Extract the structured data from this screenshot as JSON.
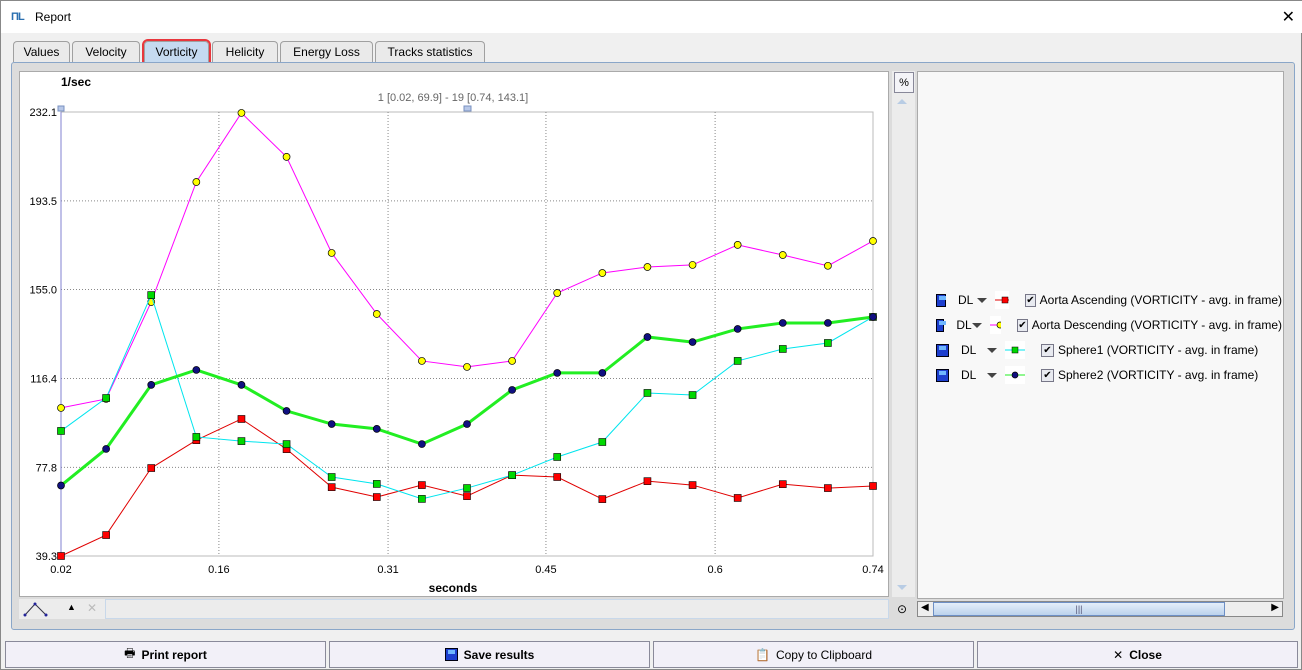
{
  "window": {
    "title": "Report"
  },
  "tabs": [
    {
      "label": "Values"
    },
    {
      "label": "Velocity"
    },
    {
      "label": "Vorticity",
      "active": true
    },
    {
      "label": "Helicity"
    },
    {
      "label": "Energy Loss"
    },
    {
      "label": "Tracks statistics"
    }
  ],
  "percent_button": "%",
  "legend": [
    {
      "dl": "DL",
      "label": "Aorta Ascending (VORTICITY  - avg. in frame)",
      "line": "#e00000",
      "marker": "#ff0000",
      "shape": "square",
      "checked": true
    },
    {
      "dl": "DL",
      "label": "Aorta Descending (VORTICITY  - avg. in frame)",
      "line": "#ff00ff",
      "marker": "#ffff00",
      "shape": "circle",
      "checked": true
    },
    {
      "dl": "DL",
      "label": "Sphere1 (VORTICITY  - avg. in frame)",
      "line": "#00e5ee",
      "marker": "#00d800",
      "shape": "square",
      "checked": true
    },
    {
      "dl": "DL",
      "label": "Sphere2 (VORTICITY  - avg. in frame)",
      "line": "#22ee22",
      "marker": "#101080",
      "shape": "circle",
      "checked": true
    }
  ],
  "buttons": {
    "print": "Print report",
    "save": "Save results",
    "copy": "Copy to Clipboard",
    "close": "Close"
  },
  "chart_data": {
    "type": "line",
    "ylabel": "1/sec",
    "xlabel": "seconds",
    "cursor_readout": "1 [0.02, 69.9] - 19 [0.74, 143.1]",
    "xlim": [
      0.02,
      0.74
    ],
    "ylim": [
      39.3,
      232.1
    ],
    "xticks": [
      "0.02",
      "0.16",
      "0.31",
      "0.45",
      "0.6",
      "0.74"
    ],
    "yticks": [
      "39.3",
      "77.8",
      "116.4",
      "155.0",
      "193.5",
      "232.1"
    ],
    "grid": true,
    "x": [
      0.02,
      0.06,
      0.1,
      0.14,
      0.18,
      0.22,
      0.26,
      0.3,
      0.34,
      0.38,
      0.42,
      0.46,
      0.5,
      0.54,
      0.58,
      0.62,
      0.66,
      0.7,
      0.74
    ],
    "series": [
      {
        "name": "Aorta Ascending (VORTICITY  - avg. in frame)",
        "values": [
          39.3,
          48.4,
          77.5,
          89.6,
          98.8,
          85.7,
          69.2,
          64.9,
          70.1,
          65.3,
          74.4,
          73.6,
          64.0,
          71.8,
          70.1,
          64.5,
          70.5,
          68.8,
          69.7
        ]
      },
      {
        "name": "Aorta Descending (VORTICITY  - avg. in frame)",
        "values": [
          103.6,
          107.5,
          149.6,
          201.7,
          231.7,
          212.6,
          170.9,
          144.4,
          124.0,
          121.4,
          124.0,
          153.5,
          162.2,
          164.8,
          165.7,
          174.4,
          170.0,
          165.3,
          176.1
        ]
      },
      {
        "name": "Sphere1 (VORTICITY  - avg. in frame)",
        "values": [
          93.6,
          107.9,
          152.6,
          91.0,
          89.2,
          87.9,
          73.6,
          70.6,
          64.1,
          68.8,
          74.4,
          82.3,
          88.8,
          110.1,
          109.2,
          124.0,
          129.2,
          131.8,
          143.1
        ]
      },
      {
        "name": "Sphere2 (VORTICITY  - avg. in frame)",
        "values": [
          69.9,
          85.8,
          113.6,
          120.1,
          113.6,
          102.3,
          96.6,
          94.5,
          87.9,
          96.6,
          111.4,
          118.8,
          118.8,
          134.4,
          132.2,
          137.9,
          140.5,
          140.5,
          143.1
        ]
      }
    ]
  }
}
